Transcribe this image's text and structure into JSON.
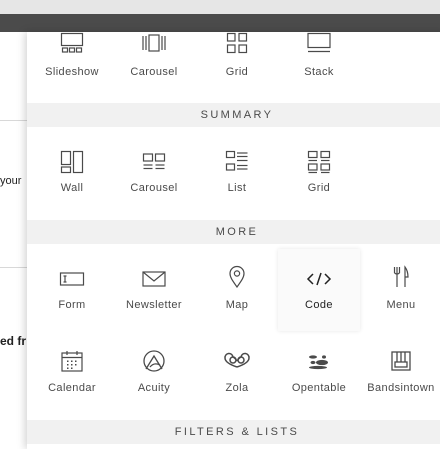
{
  "background": {
    "text_1": "your",
    "text_2": "ed fr"
  },
  "top_row": {
    "items": [
      {
        "label": "Slideshow",
        "icon": "slideshow-icon"
      },
      {
        "label": "Carousel",
        "icon": "carousel-icon"
      },
      {
        "label": "Grid",
        "icon": "grid-icon"
      },
      {
        "label": "Stack",
        "icon": "stack-icon"
      }
    ]
  },
  "summary": {
    "title": "SUMMARY",
    "items": [
      {
        "label": "Wall",
        "icon": "wall-icon"
      },
      {
        "label": "Carousel",
        "icon": "summary-carousel-icon"
      },
      {
        "label": "List",
        "icon": "list-icon"
      },
      {
        "label": "Grid",
        "icon": "summary-grid-icon"
      }
    ]
  },
  "more": {
    "title": "MORE",
    "row1": [
      {
        "label": "Form",
        "icon": "form-icon"
      },
      {
        "label": "Newsletter",
        "icon": "newsletter-icon"
      },
      {
        "label": "Map",
        "icon": "map-pin-icon"
      },
      {
        "label": "Code",
        "icon": "code-icon"
      },
      {
        "label": "Menu",
        "icon": "menu-icon"
      }
    ],
    "row2": [
      {
        "label": "Calendar",
        "icon": "calendar-icon"
      },
      {
        "label": "Acuity",
        "icon": "acuity-icon"
      },
      {
        "label": "Zola",
        "icon": "zola-icon"
      },
      {
        "label": "Opentable",
        "icon": "opentable-icon"
      },
      {
        "label": "Bandsintown",
        "icon": "bandsintown-icon"
      }
    ]
  },
  "filters": {
    "title": "FILTERS & LISTS"
  },
  "colors": {
    "icon": "#4a4a4a",
    "section_bg": "#f1f1f1",
    "dark_bar": "#4b4b4b"
  }
}
